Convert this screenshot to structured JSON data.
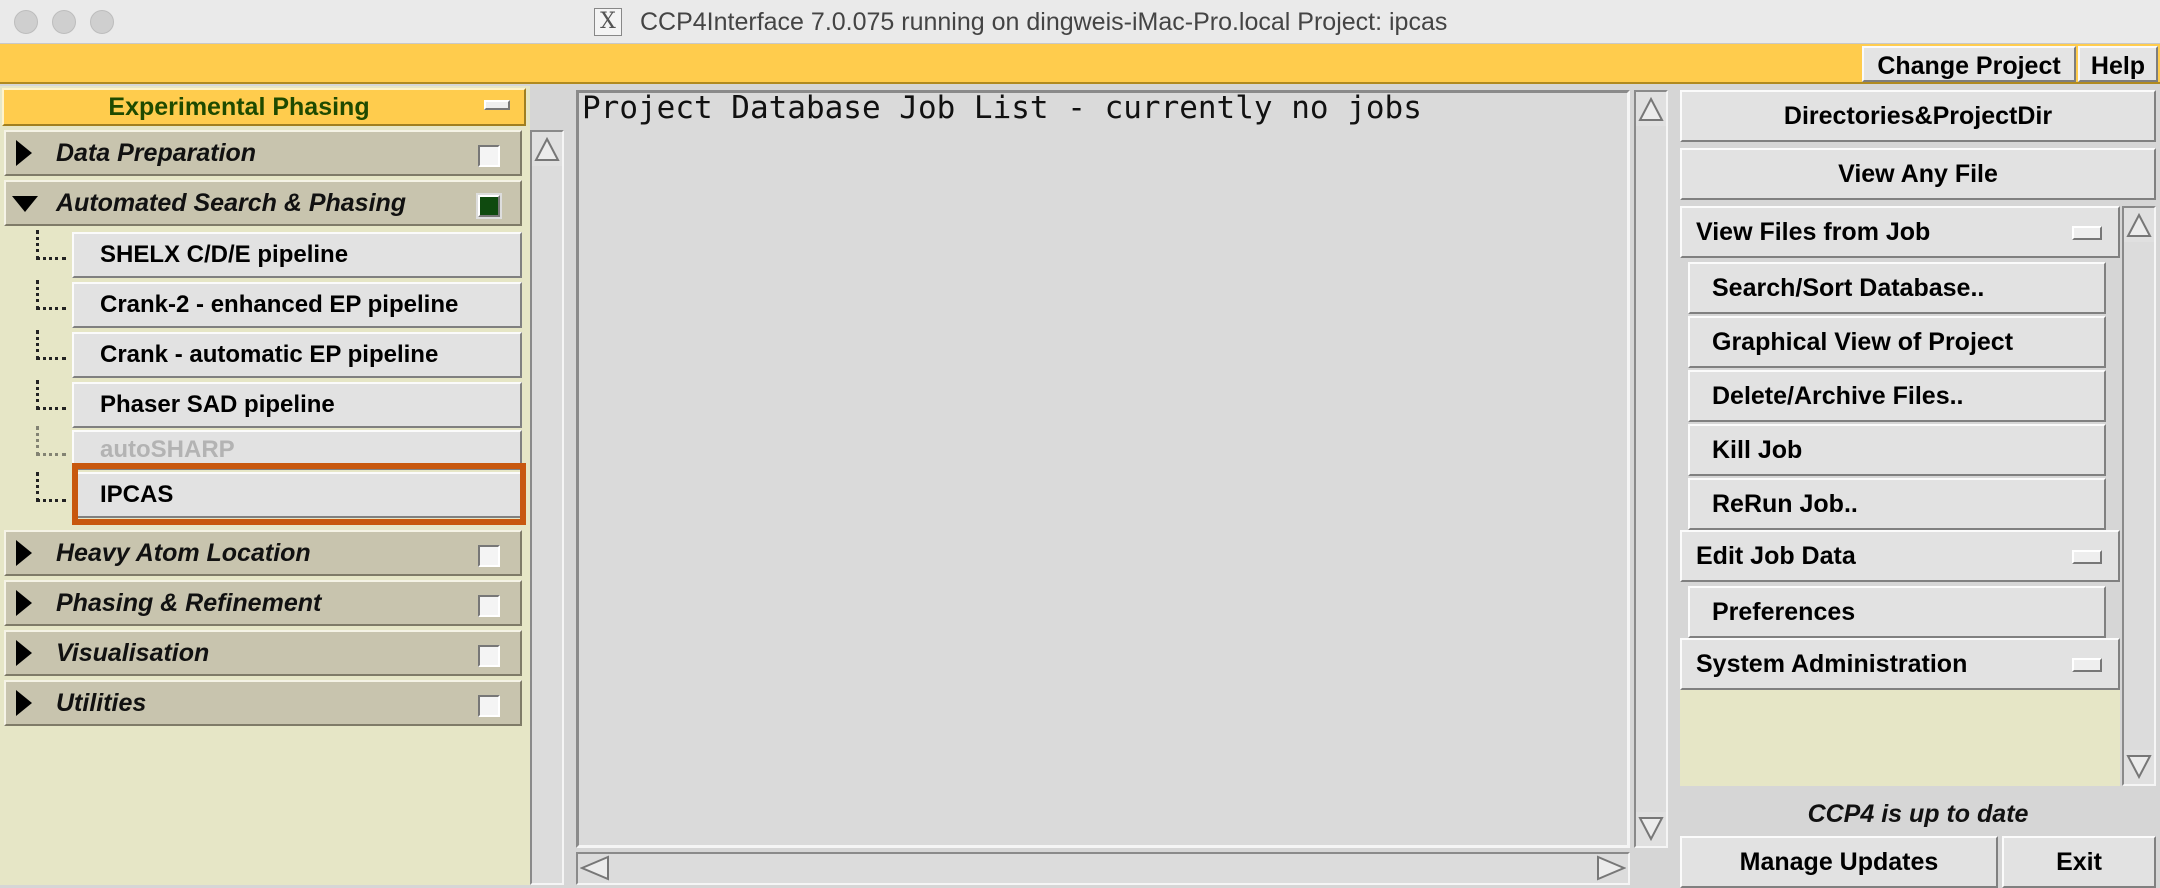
{
  "window": {
    "x_icon": "X",
    "title": "CCP4Interface 7.0.075 running on dingweis-iMac-Pro.local   Project: ipcas"
  },
  "menubar": {
    "change_project": "Change Project",
    "help": "Help"
  },
  "left": {
    "header": "Experimental Phasing",
    "folders_top": [
      {
        "label": "Data Preparation",
        "expanded": false,
        "checked": false
      },
      {
        "label": "Automated Search & Phasing",
        "expanded": true,
        "checked": true
      }
    ],
    "subitems": [
      {
        "label": "SHELX C/D/E pipeline",
        "disabled": false
      },
      {
        "label": "Crank-2 - enhanced EP pipeline",
        "disabled": false
      },
      {
        "label": "Crank - automatic EP pipeline",
        "disabled": false
      },
      {
        "label": "Phaser SAD pipeline",
        "disabled": false
      },
      {
        "label": "autoSHARP",
        "disabled": true
      },
      {
        "label": "IPCAS",
        "disabled": false,
        "highlighted": true
      }
    ],
    "folders_bottom": [
      {
        "label": "Heavy Atom Location"
      },
      {
        "label": "Phasing & Refinement"
      },
      {
        "label": "Visualisation"
      },
      {
        "label": "Utilities"
      }
    ]
  },
  "main": {
    "job_list_text": "Project Database Job List - currently no jobs"
  },
  "right": {
    "directories": "Directories&ProjectDir",
    "view_any_file": "View Any File",
    "view_files_from_job": "View Files from Job",
    "search_sort": "Search/Sort Database..",
    "graphical_view": "Graphical View of Project",
    "delete_archive": "Delete/Archive Files..",
    "kill_job": "Kill Job",
    "rerun_job": "ReRun Job..",
    "edit_job_data": "Edit Job Data",
    "preferences": "Preferences",
    "system_admin": "System Administration",
    "status": "CCP4 is up to date",
    "manage_updates": "Manage Updates",
    "exit": "Exit"
  },
  "colors": {
    "accent_yellow": "#ffcc4d",
    "panel_cream": "#e6e6c6",
    "highlight_orange": "#c8580e",
    "checked_green": "#0f4a0f"
  }
}
